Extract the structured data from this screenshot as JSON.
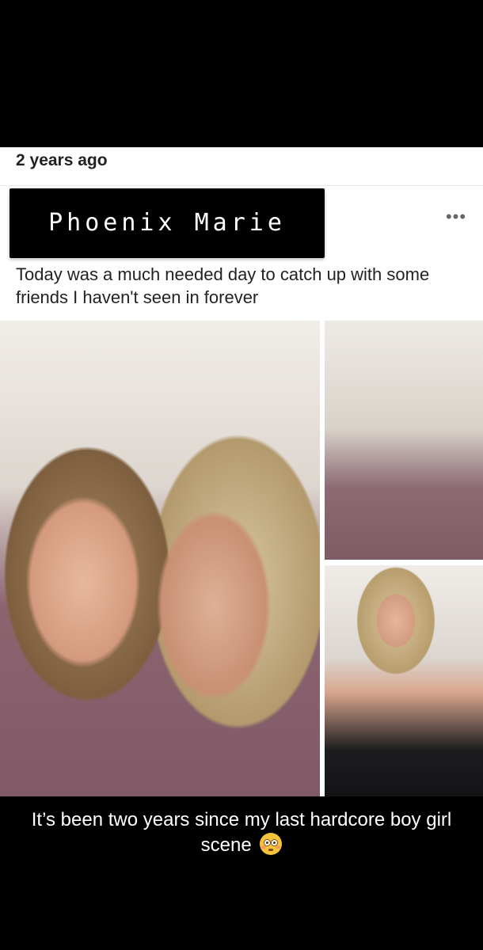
{
  "post": {
    "timestamp": "2 years ago",
    "author": "Phoenix Marie",
    "more_label": "•••",
    "caption": "Today was a much needed day to catch up with some friends I haven't seen in forever"
  },
  "overlay": {
    "text": "It’s been two years since my last hardcore boy girl scene",
    "emoji": "flushed-face-icon"
  },
  "photos": [
    {
      "id": "main",
      "content": "selfie-photo"
    },
    {
      "id": "top-right",
      "content": "group-selfie-photo"
    },
    {
      "id": "bottom-right",
      "content": "portrait-selfie-photo"
    }
  ]
}
